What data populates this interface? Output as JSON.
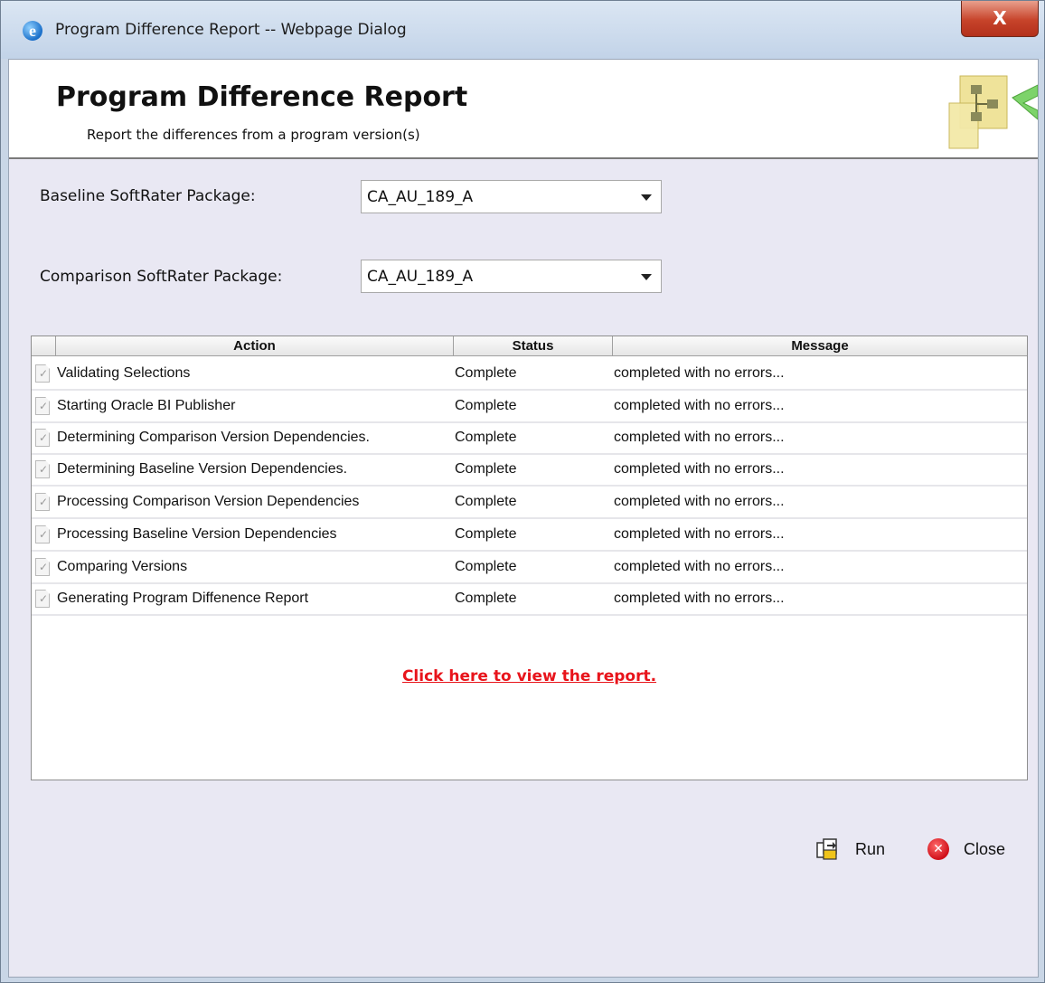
{
  "window": {
    "title": "Program Difference Report -- Webpage Dialog",
    "close_glyph": "X"
  },
  "header": {
    "title": "Program Difference Report",
    "subtitle": "Report the differences from a program version(s)",
    "logo_icon": "package-diagram-icon"
  },
  "form": {
    "baseline_label": "Baseline SoftRater Package:",
    "baseline_value": "CA_AU_189_A",
    "comparison_label": "Comparison SoftRater Package:",
    "comparison_value": "CA_AU_189_A"
  },
  "grid": {
    "columns": [
      "Action",
      "Status",
      "Message"
    ],
    "rows": [
      {
        "action": "Validating Selections",
        "status": "Complete",
        "message": "completed with no errors..."
      },
      {
        "action": "Starting Oracle BI Publisher",
        "status": "Complete",
        "message": "completed with no errors..."
      },
      {
        "action": "Determining Comparison Version Dependencies.",
        "status": "Complete",
        "message": "completed with no errors..."
      },
      {
        "action": "Determining Baseline Version Dependencies.",
        "status": "Complete",
        "message": "completed with no errors..."
      },
      {
        "action": "Processing Comparison Version Dependencies",
        "status": "Complete",
        "message": "completed with no errors..."
      },
      {
        "action": "Processing Baseline Version Dependencies",
        "status": "Complete",
        "message": "completed with no errors..."
      },
      {
        "action": "Comparing Versions",
        "status": "Complete",
        "message": "completed with no errors..."
      },
      {
        "action": "Generating Program Diffenence Report",
        "status": "Complete",
        "message": "completed with no errors..."
      }
    ]
  },
  "report_link": "Click here to view the report.",
  "buttons": {
    "run_label": "Run",
    "close_label": "Close"
  },
  "colors": {
    "link": "#e8141b",
    "client_background": "#e9e8f3"
  }
}
